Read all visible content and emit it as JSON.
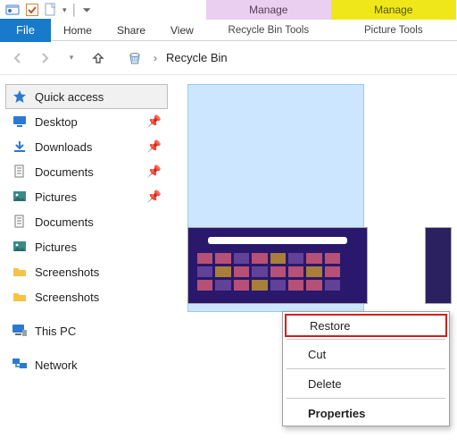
{
  "tooltabs": {
    "a": {
      "header": "Manage",
      "sub": "Recycle Bin Tools"
    },
    "b": {
      "header": "Manage",
      "sub": "Picture Tools"
    }
  },
  "ribbon": {
    "file": "File",
    "tabs": [
      "Home",
      "Share",
      "View"
    ]
  },
  "address": {
    "location": "Recycle Bin"
  },
  "sidebar": {
    "quick_access": "Quick access",
    "items": [
      {
        "label": "Desktop",
        "pinned": true,
        "icon": "monitor"
      },
      {
        "label": "Downloads",
        "pinned": true,
        "icon": "download"
      },
      {
        "label": "Documents",
        "pinned": true,
        "icon": "doc"
      },
      {
        "label": "Pictures",
        "pinned": true,
        "icon": "picture"
      },
      {
        "label": "Documents",
        "pinned": false,
        "icon": "doc"
      },
      {
        "label": "Pictures",
        "pinned": false,
        "icon": "picture"
      },
      {
        "label": "Screenshots",
        "pinned": false,
        "icon": "folder"
      },
      {
        "label": "Screenshots",
        "pinned": false,
        "icon": "folder"
      }
    ],
    "this_pc": "This PC",
    "network": "Network"
  },
  "context_menu": {
    "restore": "Restore",
    "cut": "Cut",
    "delete": "Delete",
    "properties": "Properties"
  }
}
